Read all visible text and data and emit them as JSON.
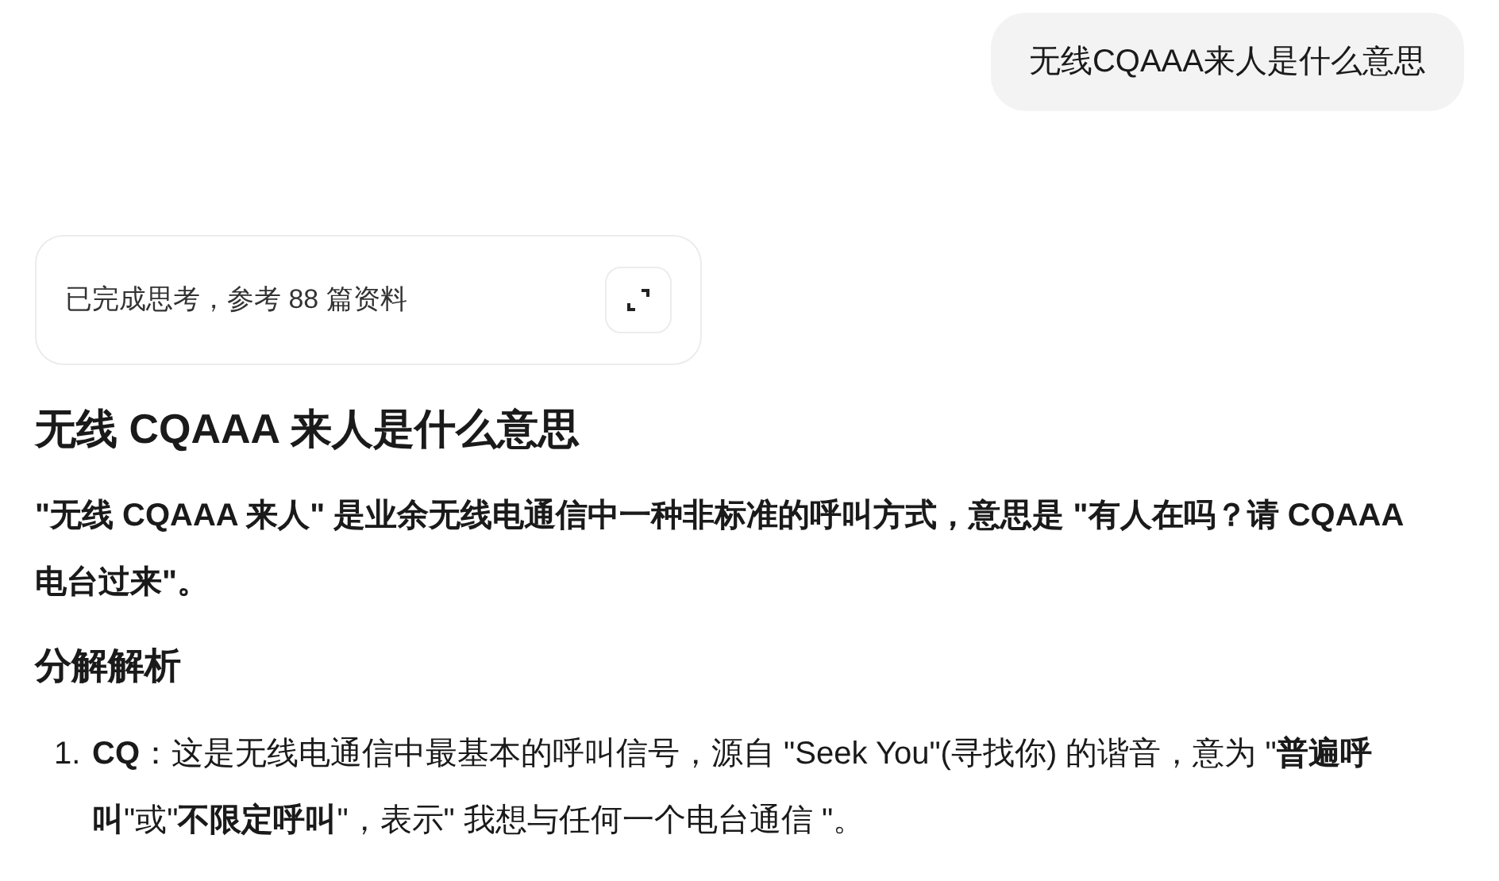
{
  "user_message": "无线CQAAA来人是什么意思",
  "thinking": {
    "label": "已完成思考，参考 88 篇资料"
  },
  "answer": {
    "title": "无线 CQAAA 来人是什么意思",
    "summary": "\"无线 CQAAA 来人\" 是业余无线电通信中一种非标准的呼叫方式，意思是 \"有人在吗？请 CQAAA 电台过来\"。",
    "section_title": "分解解析",
    "items": [
      {
        "number": "1.",
        "text": "**CQ**：这是无线电通信中最基本的呼叫信号，源自 \"Seek You\"(寻找你) 的谐音，意为 \"**普遍呼叫**\"或\"**不限定呼叫**\"，表示\" 我想与任何一个电台通信 \"。"
      }
    ]
  }
}
